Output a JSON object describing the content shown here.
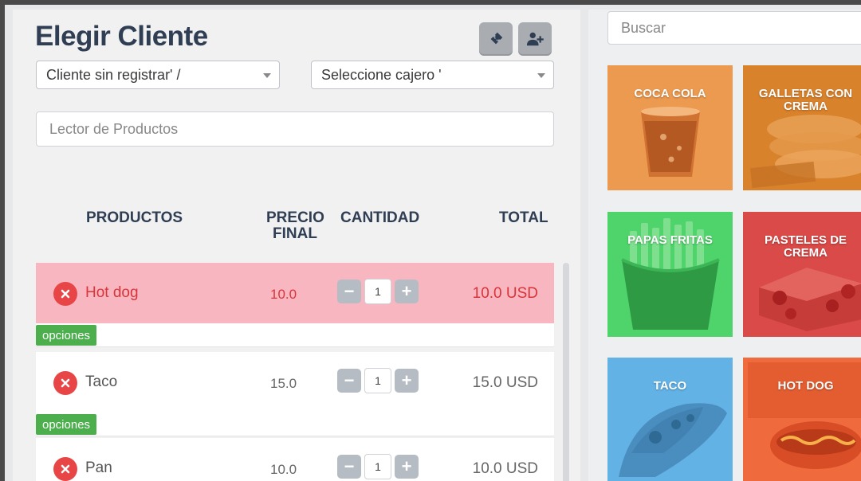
{
  "header": {
    "title": "Elegir Cliente",
    "ticket_icon": "ticket-icon",
    "add_user_icon": "user-plus-icon"
  },
  "selects": {
    "cliente": "Cliente sin registrar' /",
    "cajero": "Seleccione cajero '"
  },
  "scanner": {
    "placeholder": "Lector de Productos"
  },
  "table": {
    "headers": {
      "productos": "PRODUCTOS",
      "precio_1": "PRECIO",
      "precio_2": "FINAL",
      "cantidad": "CANTIDAD",
      "total": "TOTAL"
    },
    "rows": [
      {
        "name": "Hot dog",
        "price": "10.0",
        "qty": "1",
        "total": "10.0 USD",
        "options": "opciones"
      },
      {
        "name": "Taco",
        "price": "15.0",
        "qty": "1",
        "total": "15.0 USD",
        "options": "opciones"
      },
      {
        "name": "Pan",
        "price": "10.0",
        "qty": "1",
        "total": "10.0 USD"
      }
    ]
  },
  "catalog": {
    "search_placeholder": "Buscar",
    "products": [
      {
        "label": "COCA COLA"
      },
      {
        "label": "GALLETAS CON CREMA"
      },
      {
        "label": "PAPAS FRITAS"
      },
      {
        "label": "PASTELES DE CREMA"
      },
      {
        "label": "TACO"
      },
      {
        "label": "HOT DOG"
      }
    ]
  },
  "colors": {
    "active_row": "#f8b6c0",
    "delete": "#e84646",
    "options_badge": "#4cae4c",
    "title": "#2f3e53"
  }
}
